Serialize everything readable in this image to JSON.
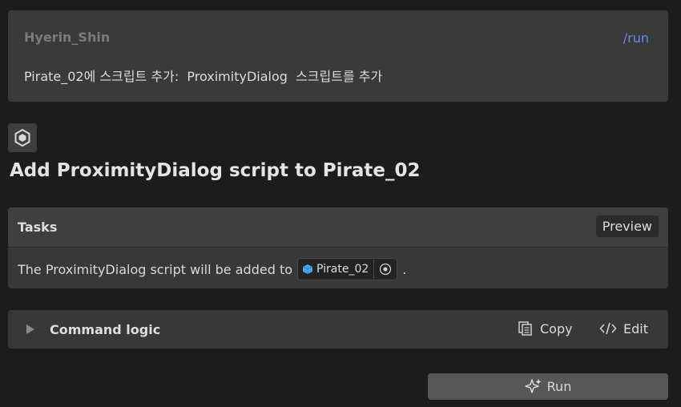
{
  "message": {
    "user": "Hyerin_Shin",
    "command": "/run",
    "text": "Pirate_02에 스크립트 추가:  ProximityDialog  스크립트를 추가"
  },
  "title": "Add ProximityDialog script to Pirate_02",
  "tasks": {
    "header": "Tasks",
    "preview_label": "Preview",
    "sentence_prefix": "The ProximityDialog script will be added to",
    "object_name": "Pirate_02",
    "sentence_suffix": "."
  },
  "command_logic": {
    "label": "Command logic",
    "copy_label": "Copy",
    "edit_label": "Edit"
  },
  "run_label": "Run",
  "colors": {
    "accent_link": "#5c8df0",
    "cube_icon": "#4aa7e6"
  }
}
